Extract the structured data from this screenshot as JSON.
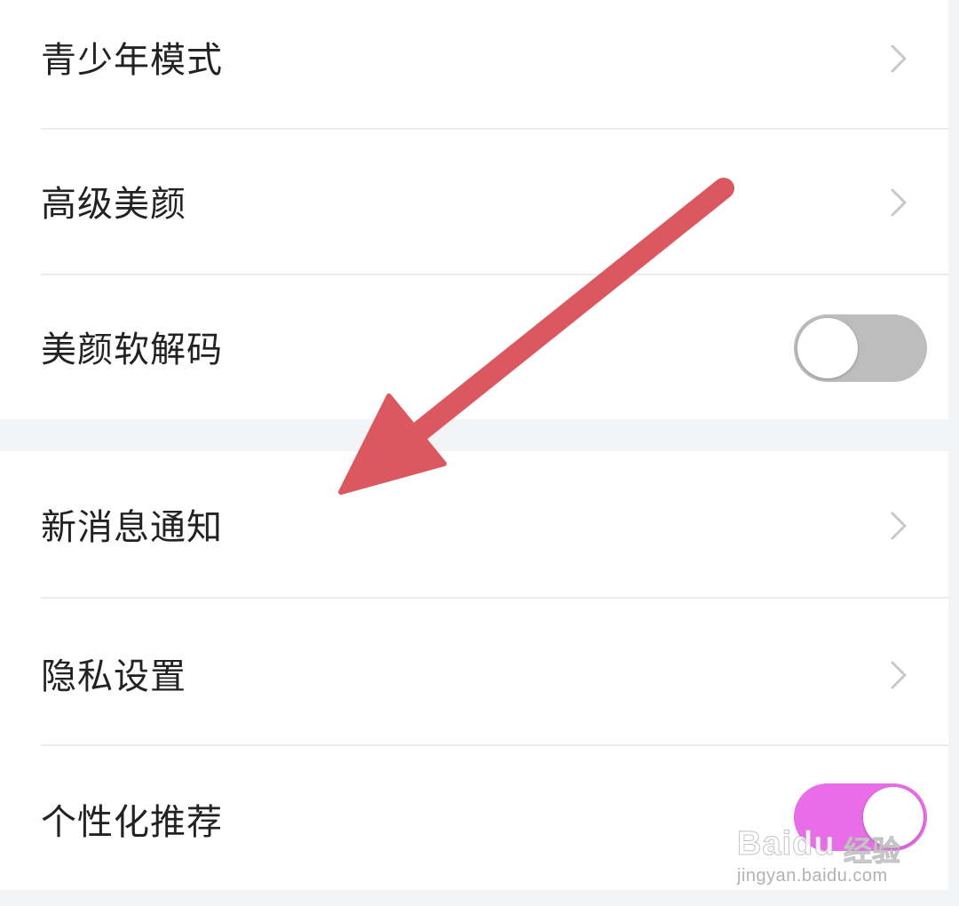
{
  "settings": {
    "rows": [
      {
        "label": "青少年模式",
        "control": "chevron"
      },
      {
        "label": "高级美颜",
        "control": "chevron"
      },
      {
        "label": "美颜软解码",
        "control": "toggle",
        "state": "off"
      },
      {
        "label": "新消息通知",
        "control": "chevron"
      },
      {
        "label": "隐私设置",
        "control": "chevron"
      },
      {
        "label": "个性化推荐",
        "control": "toggle",
        "state": "on"
      }
    ]
  },
  "icons": {
    "chevron": "chevron-right-icon",
    "arrow": "red-arrow-annotation"
  },
  "colors": {
    "background": "#ffffff",
    "section_gap": "#f3f4f5",
    "text": "#222222",
    "divider": "#ececec",
    "chevron": "#c8c8c8",
    "toggle_off": "#bdbdbd",
    "toggle_on": "#e96de8",
    "annotation_arrow": "#dc5860"
  },
  "watermark": {
    "brand": "Baidu",
    "cn": "经验",
    "url": "jingyan.baidu.com"
  }
}
